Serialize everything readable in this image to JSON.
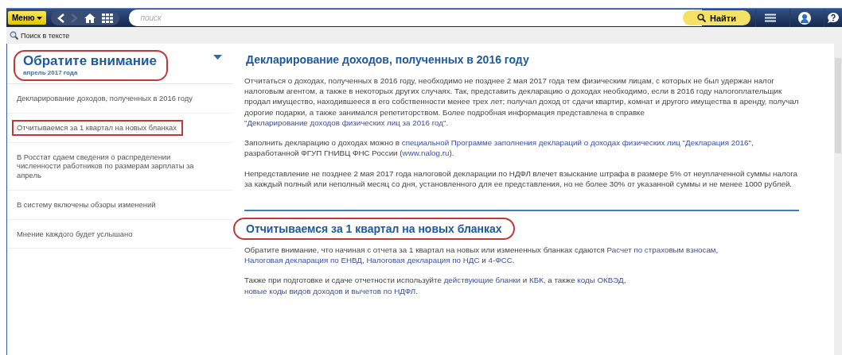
{
  "toolbar": {
    "menu_button": "Меню",
    "search": {
      "placeholder": "поиск"
    },
    "find_button": "Найти"
  },
  "text_search": "Поиск в тексте",
  "sidebar": {
    "title": "Обратите внимание",
    "subtitle": "апрель 2017 года",
    "circled": true,
    "items": [
      {
        "label": "Декларирование доходов, полученных в 2016 году",
        "highlighted": false
      },
      {
        "label": "Отчитываемся за 1 квартал на новых бланках",
        "highlighted": true
      },
      {
        "label": "В Росстат сдаем сведения о распределении численности работников по размерам зарплаты за апрель",
        "highlighted": false
      },
      {
        "label": "В систему включены обзоры изменений",
        "highlighted": false
      },
      {
        "label": "Мнение каждого будет услышано",
        "highlighted": false
      }
    ]
  },
  "articles": [
    {
      "title": "Декларирование доходов, полученных в 2016 году",
      "circled": false,
      "paragraphs": [
        [
          {
            "kind": "text",
            "text": "Отчитаться о доходах, полученных в 2016 году, необходимо не позднее 2 мая 2017 года тем физическим лицам, с которых не был удержан налог налоговым агентом, а также в некоторых других случаях. Так, представить декларацию о доходах необходимо, если в 2016 году налогоплательщик продал имущество, находившееся в его собственности менее трех лет; получал доход от сдачи квартир, комнат и другого имущества в аренду, получал дорогие подарки, а также занимался репетиторством. Более подробная информация представлена в справке "
          },
          {
            "kind": "link",
            "text": "\"Декларирование доходов физических лиц за 2016 год\""
          },
          {
            "kind": "text",
            "text": "."
          }
        ],
        [
          {
            "kind": "text",
            "text": "Заполнить декларацию о доходах можно в "
          },
          {
            "kind": "link",
            "text": "специальной Программе заполнения деклараций о доходах физических лиц \"Декларация 2016\""
          },
          {
            "kind": "text",
            "text": ", разработанной ФГУП ГНИВЦ ФНС России ("
          },
          {
            "kind": "link",
            "text": "www.nalog.ru"
          },
          {
            "kind": "text",
            "text": ")."
          }
        ],
        [
          {
            "kind": "text",
            "text": "Непредставление не позднее 2 мая 2017 года налоговой декларации по НДФЛ влечет взыскание штрафа в размере 5% от неуплаченной суммы налога за каждый полный или неполный месяц со дня, установленного для ее представления, но не более 30% от указанной суммы и не менее 1000 рублей."
          }
        ]
      ]
    },
    {
      "title": "Отчитываемся за 1 квартал на новых бланках",
      "circled": true,
      "paragraphs": [
        [
          {
            "kind": "text",
            "text": "Обратите внимание, что начиная с отчета за 1 квартал на новых или измененных бланках сдаются "
          },
          {
            "kind": "link",
            "text": "Расчет по страховым взносам"
          },
          {
            "kind": "text",
            "text": ", "
          },
          {
            "kind": "link",
            "text": "Налоговая декларация по ЕНВД"
          },
          {
            "kind": "text",
            "text": ", "
          },
          {
            "kind": "link",
            "text": "Налоговая декларация по НДС"
          },
          {
            "kind": "text",
            "text": " и "
          },
          {
            "kind": "link",
            "text": "4-ФСС"
          },
          {
            "kind": "text",
            "text": "."
          }
        ],
        [
          {
            "kind": "text",
            "text": "Также при подготовке и сдаче отчетности используйте "
          },
          {
            "kind": "link",
            "text": "действующие бланки"
          },
          {
            "kind": "text",
            "text": " и "
          },
          {
            "kind": "link",
            "text": "КБК"
          },
          {
            "kind": "text",
            "text": ", а также "
          },
          {
            "kind": "link",
            "text": "коды ОКВЭД"
          },
          {
            "kind": "text",
            "text": ", "
          },
          {
            "kind": "link",
            "text": "новые коды видов доходов и вычетов по НДФЛ"
          },
          {
            "kind": "text",
            "text": "."
          }
        ]
      ]
    }
  ]
}
